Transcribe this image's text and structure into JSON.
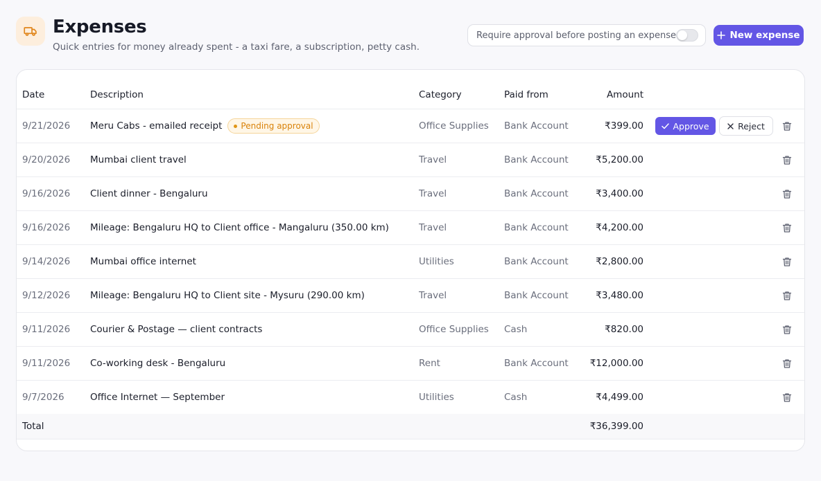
{
  "header": {
    "title": "Expenses",
    "subtitle": "Quick entries for money already spent - a taxi fare, a subscription, petty cash.",
    "logo_icon": "truck-icon",
    "require_approval_label": "Require approval before posting an expense",
    "require_approval_enabled": false,
    "new_expense_label": "New expense"
  },
  "table": {
    "columns": {
      "date": "Date",
      "description": "Description",
      "category": "Category",
      "paid_from": "Paid from",
      "amount": "Amount"
    },
    "rows": [
      {
        "date": "9/21/2026",
        "description": "Meru Cabs - emailed receipt",
        "badge": "Pending approval",
        "category": "Office Supplies",
        "paid_from": "Bank Account",
        "amount": "₹399.00",
        "approve_label": "Approve",
        "reject_label": "Reject"
      },
      {
        "date": "9/20/2026",
        "description": "Mumbai client travel",
        "category": "Travel",
        "paid_from": "Bank Account",
        "amount": "₹5,200.00"
      },
      {
        "date": "9/16/2026",
        "description": "Client dinner - Bengaluru",
        "category": "Travel",
        "paid_from": "Bank Account",
        "amount": "₹3,400.00"
      },
      {
        "date": "9/16/2026",
        "description": "Mileage: Bengaluru HQ to Client office - Mangaluru (350.00 km)",
        "category": "Travel",
        "paid_from": "Bank Account",
        "amount": "₹4,200.00"
      },
      {
        "date": "9/14/2026",
        "description": "Mumbai office internet",
        "category": "Utilities",
        "paid_from": "Bank Account",
        "amount": "₹2,800.00"
      },
      {
        "date": "9/12/2026",
        "description": "Mileage: Bengaluru HQ to Client site - Mysuru (290.00 km)",
        "category": "Travel",
        "paid_from": "Bank Account",
        "amount": "₹3,480.00"
      },
      {
        "date": "9/11/2026",
        "description": "Courier & Postage — client contracts",
        "category": "Office Supplies",
        "paid_from": "Cash",
        "amount": "₹820.00"
      },
      {
        "date": "9/11/2026",
        "description": "Co-working desk - Bengaluru",
        "category": "Rent",
        "paid_from": "Bank Account",
        "amount": "₹12,000.00"
      },
      {
        "date": "9/7/2026",
        "description": "Office Internet — September",
        "category": "Utilities",
        "paid_from": "Cash",
        "amount": "₹4,499.00"
      }
    ],
    "total_label": "Total",
    "total_amount": "₹36,399.00"
  },
  "colors": {
    "accent": "#6356e5",
    "pending": "#d9820a",
    "logo_bg": "#fdeedd",
    "logo_icon": "#e0851a"
  }
}
